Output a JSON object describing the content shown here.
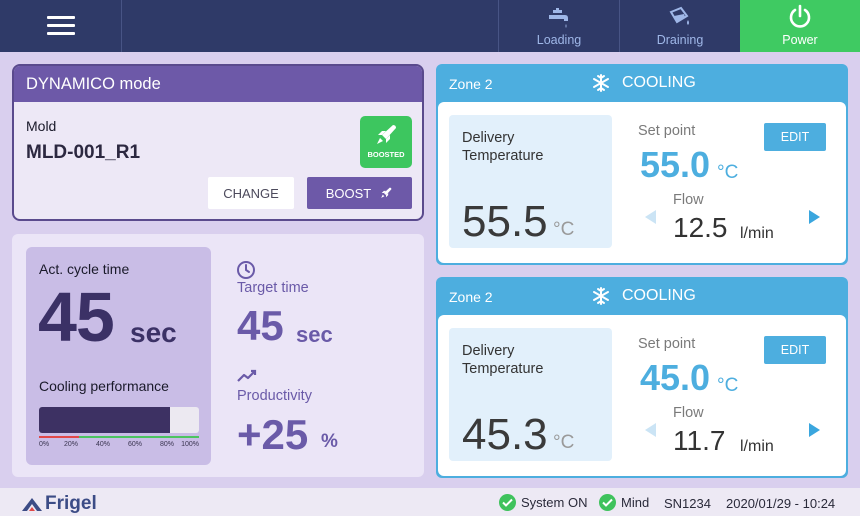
{
  "topbar": {
    "loading_label": "Loading",
    "draining_label": "Draining",
    "power_label": "Power",
    "power_color": "#3fca62"
  },
  "dynamico": {
    "title": "DYNAMICO mode",
    "mold_label": "Mold",
    "mold_value": "MLD-001_R1",
    "badge_label": "BOOSTED",
    "change_label": "CHANGE",
    "boost_label": "BOOST"
  },
  "cycle": {
    "act_label": "Act. cycle time",
    "act_value": "45",
    "act_unit": "sec",
    "perf_label": "Cooling performance",
    "perf_fraction": 0.82,
    "perf_ticks": [
      "0%",
      "20%",
      "40%",
      "60%",
      "80%",
      "100%"
    ],
    "target_label": "Target time",
    "target_value": "45",
    "target_unit": "sec",
    "prod_label": "Productivity",
    "prod_value": "+25",
    "prod_unit": "%"
  },
  "zones": [
    {
      "name": "Zone 2",
      "status": "COOLING",
      "delivery_label": "Delivery Temperature",
      "delivery_value": "55.5",
      "delivery_unit": "°C",
      "setpoint_label": "Set point",
      "setpoint_value": "55.0",
      "setpoint_unit": "°C",
      "edit_label": "EDIT",
      "flow_label": "Flow",
      "flow_value": "12.5",
      "flow_unit": "l/min"
    },
    {
      "name": "Zone 2",
      "status": "COOLING",
      "delivery_label": "Delivery Temperature",
      "delivery_value": "45.3",
      "delivery_unit": "°C",
      "setpoint_label": "Set point",
      "setpoint_value": "45.0",
      "setpoint_unit": "°C",
      "edit_label": "EDIT",
      "flow_label": "Flow",
      "flow_value": "11.7",
      "flow_unit": "l/min"
    }
  ],
  "statusbar": {
    "brand": "Frigel",
    "system_label": "System ON",
    "mind_label": "Mind",
    "serial": "SN1234",
    "datetime": "2020/01/29 - 10:24"
  },
  "colors": {
    "primary_purple": "#6d59a8",
    "zone_blue": "#4daedf",
    "ok_green": "#3fc25d"
  }
}
